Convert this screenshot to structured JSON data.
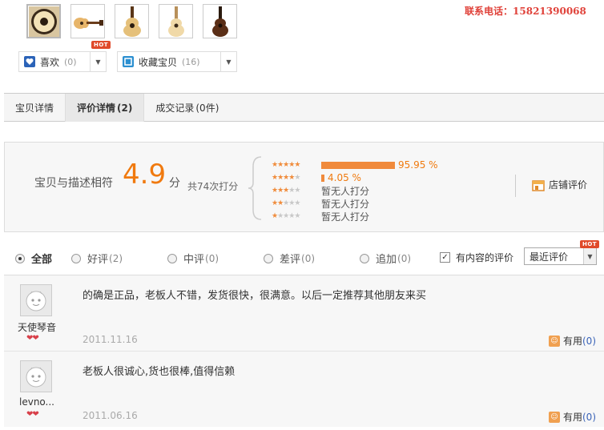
{
  "contact": {
    "label": "联系电话：",
    "phone": "15821390068"
  },
  "thumbnails": [
    {
      "icon": "guitar-front-icon",
      "active": true
    },
    {
      "icon": "guitar-side-icon",
      "active": false
    },
    {
      "icon": "guitar-front-icon",
      "active": false
    },
    {
      "icon": "guitar-light-icon",
      "active": false
    },
    {
      "icon": "guitar-dark-icon",
      "active": false
    }
  ],
  "actions": {
    "like": {
      "label": "喜欢",
      "count": "(0)",
      "badge": "HOT"
    },
    "favorite": {
      "label": "收藏宝贝",
      "count": "(16)"
    }
  },
  "tabs": [
    {
      "label": "宝贝详情",
      "count": "",
      "active": false
    },
    {
      "label": "评价详情",
      "count": "(2)",
      "active": true
    },
    {
      "label": "成交记录",
      "count": "(0件)",
      "active": false
    }
  ],
  "summary": {
    "label": "宝贝与描述相符",
    "score": "4.9",
    "unit": "分",
    "count": "共74次打分",
    "distribution": [
      {
        "stars": 5,
        "percent": 95.95,
        "text": "95.95 %"
      },
      {
        "stars": 4,
        "percent": 4.05,
        "text": "4.05 %"
      },
      {
        "stars": 3,
        "percent": 0,
        "text": "暂无人打分"
      },
      {
        "stars": 2,
        "percent": 0,
        "text": "暂无人打分"
      },
      {
        "stars": 1,
        "percent": 0,
        "text": "暂无人打分"
      }
    ],
    "shop_link": "店铺评价"
  },
  "filters": {
    "all": "全部",
    "good": {
      "label": "好评",
      "count": "(2)"
    },
    "neutral": {
      "label": "中评",
      "count": "(0)"
    },
    "bad": {
      "label": "差评",
      "count": "(0)"
    },
    "append": {
      "label": "追加",
      "count": "(0)"
    },
    "with_content": "有内容的评价",
    "sort": "最近评价",
    "sort_badge": "HOT"
  },
  "reviews": [
    {
      "user": "天使琴音",
      "text": "的确是正品，老板人不错，发货很快，很满意。以后一定推荐其他朋友来买",
      "date": "2011.11.16",
      "useful_label": "有用",
      "useful_count": "(0)"
    },
    {
      "user": "levno...",
      "text": "老板人很诚心,货也很棒,值得信赖",
      "date": "2011.06.16",
      "useful_label": "有用",
      "useful_count": "(0)"
    }
  ],
  "colors": {
    "accent": "#f07a0f",
    "phone": "#e0423a",
    "link": "#3b64b8"
  }
}
